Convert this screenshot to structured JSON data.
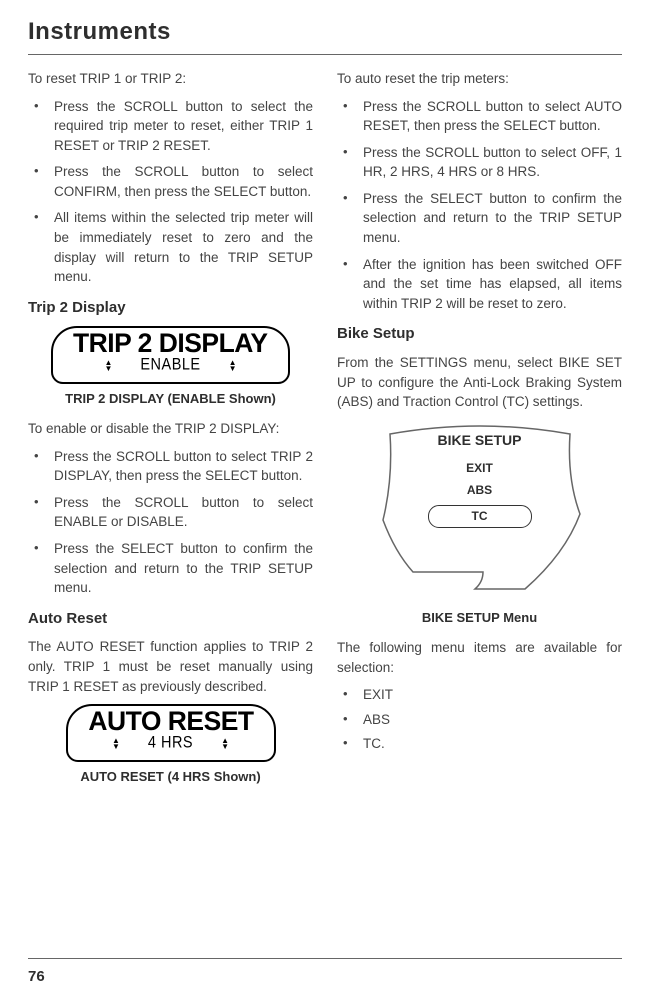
{
  "header": {
    "title": "Instruments"
  },
  "left": {
    "intro": "To reset TRIP 1 or TRIP 2:",
    "reset_list": [
      "Press the SCROLL button to select the required trip meter to reset, either TRIP 1 RESET or TRIP 2 RESET.",
      "Press the SCROLL button to select CONFIRM, then press the SELECT button.",
      "All items within the selected trip meter will be immediately reset to zero and the display will return to the TRIP SETUP menu."
    ],
    "trip2_heading": "Trip 2 Display",
    "lcd_trip2": {
      "title": "TRIP 2 DISPLAY",
      "sub": "ENABLE"
    },
    "lcd_trip2_caption": "TRIP 2 DISPLAY (ENABLE Shown)",
    "enable_intro": "To enable or disable the TRIP 2 DISPLAY:",
    "enable_list": [
      "Press the SCROLL button to select TRIP 2 DISPLAY, then press the SELECT button.",
      "Press the SCROLL button to select ENABLE or DISABLE.",
      "Press the SELECT button to confirm the selection and return to the TRIP SETUP menu."
    ],
    "auto_reset_heading": "Auto Reset",
    "auto_reset_body": "The AUTO RESET function applies to TRIP 2 only. TRIP 1 must be reset manually using TRIP 1 RESET as previously described.",
    "lcd_auto": {
      "title": "AUTO RESET",
      "sub": "4 HRS"
    },
    "lcd_auto_caption": "AUTO RESET (4 HRS Shown)"
  },
  "right": {
    "auto_intro": "To auto reset the trip meters:",
    "auto_list": [
      "Press the SCROLL button to select AUTO RESET, then press the SELECT button.",
      "Press the SCROLL button to select OFF, 1 HR, 2 HRS, 4 HRS or 8 HRS.",
      "Press the SELECT button to confirm the selection and return to the TRIP SETUP menu.",
      "After the ignition has been switched OFF and the set time has elapsed, all items within TRIP 2 will be reset to zero."
    ],
    "bike_heading": "Bike Setup",
    "bike_body": "From the SETTINGS menu, select BIKE SET UP to configure the Anti-Lock Braking System (ABS) and Traction Control (TC) settings.",
    "shield": {
      "title": "BIKE SETUP",
      "items": [
        "EXIT",
        "ABS",
        "TC"
      ],
      "selected_index": 2
    },
    "shield_caption": "BIKE SETUP Menu",
    "menu_intro": "The following menu items are available for selection:",
    "menu_items": [
      "EXIT",
      "ABS",
      "TC."
    ]
  },
  "page_number": "76"
}
